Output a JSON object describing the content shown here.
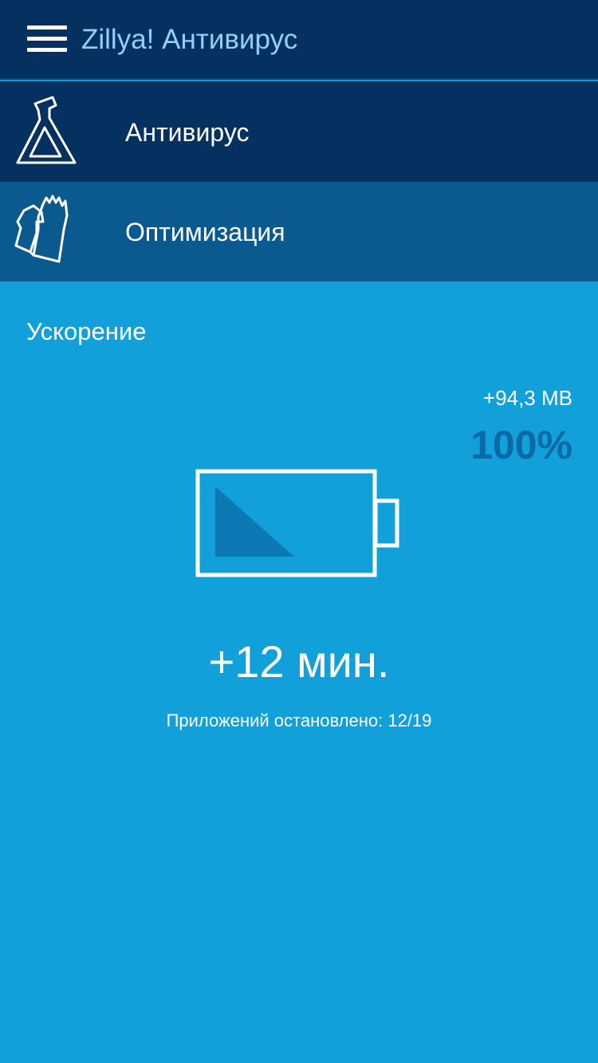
{
  "app_title": "Zillya! Антивирус",
  "nav": {
    "antivirus_label": "Антивирус",
    "optimization_label": "Оптимизация"
  },
  "boost": {
    "section_title": "Ускорение",
    "memory_freed": "+94,3 MB",
    "percent": "100%",
    "percent_value": 100,
    "time_gain": "+12 мин.",
    "apps_stopped": "Приложений остановлено: 12/19"
  },
  "colors": {
    "appbar": "#053160",
    "selected_nav": "#0b5a8f",
    "content_bg": "#11a0d9",
    "title_accent": "#8fd2f5",
    "percent_text": "#0a6aa5"
  },
  "icons": {
    "menu": "hamburger-menu-icon",
    "antivirus": "flask-icon",
    "optimization": "gloves-icon",
    "battery": "battery-icon"
  }
}
